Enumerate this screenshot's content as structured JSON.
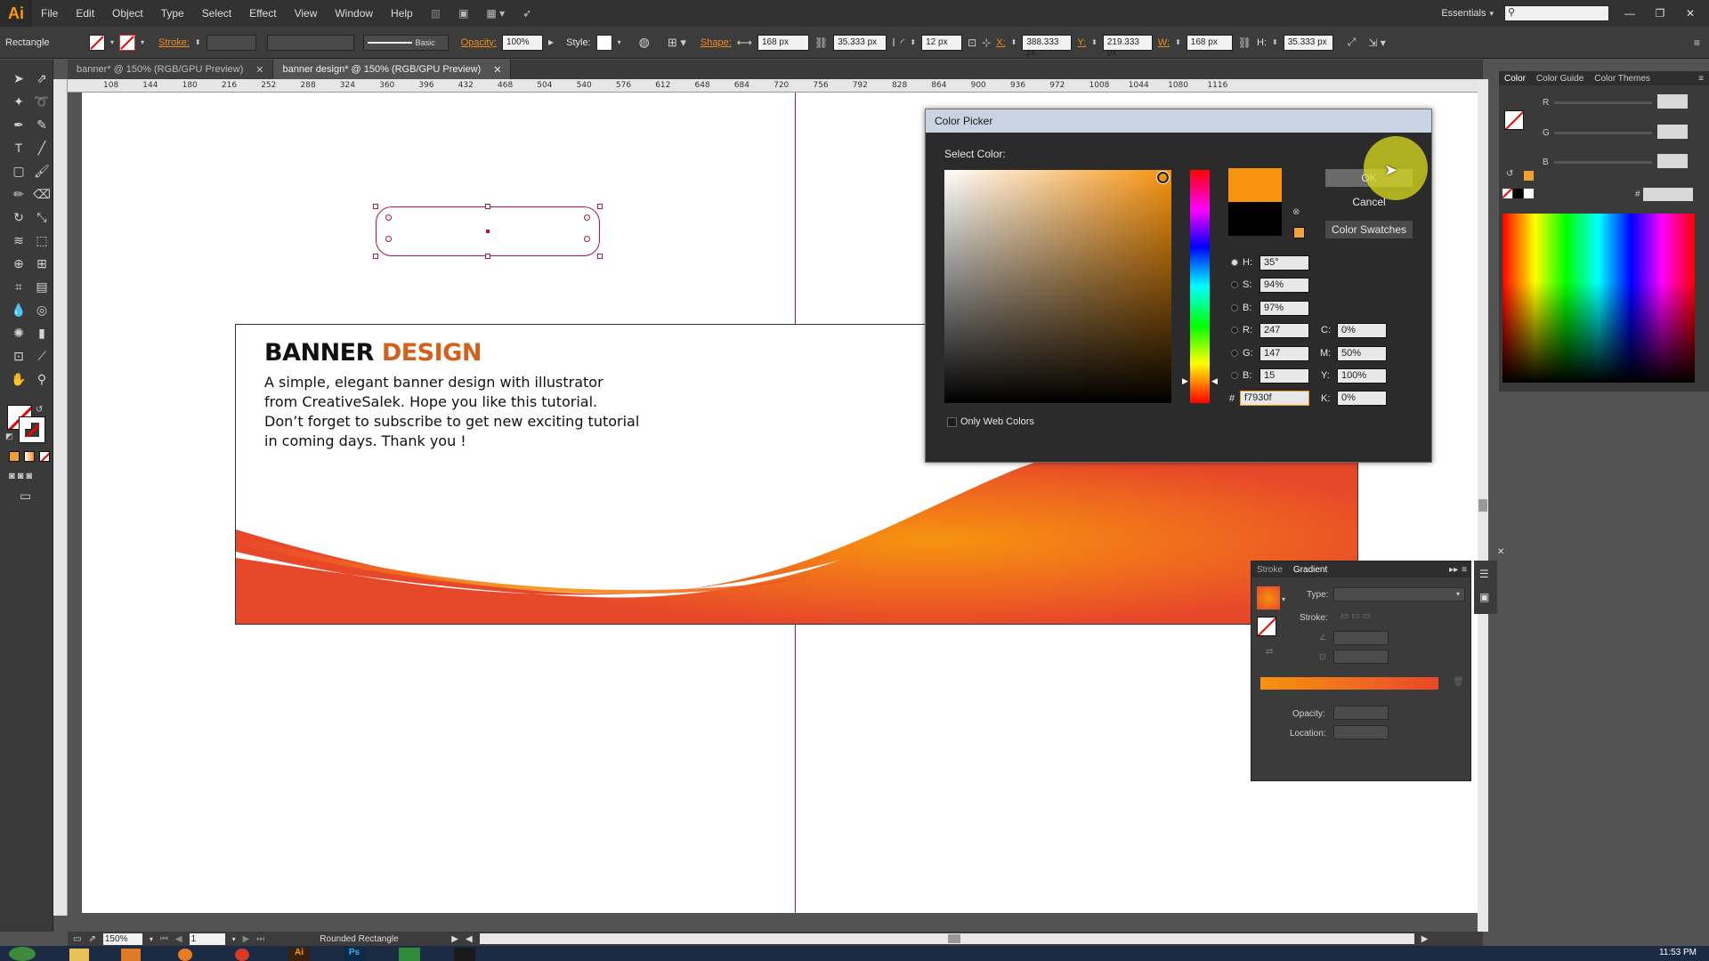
{
  "app": {
    "logo": "Ai",
    "menu": [
      "File",
      "Edit",
      "Object",
      "Type",
      "Select",
      "Effect",
      "View",
      "Window",
      "Help"
    ],
    "workspace": "Essentials"
  },
  "control_bar": {
    "tool_name": "Rectangle",
    "stroke_label": "Stroke:",
    "stroke_style": "Basic",
    "opacity_label": "Opacity:",
    "opacity_value": "100%",
    "style_label": "Style:",
    "shape_label": "Shape:",
    "width_value": "168 px",
    "height_value": "35.333 px",
    "radius_value": "12 px",
    "x_label": "X:",
    "x_value": "388.333 px",
    "y_label": "Y:",
    "y_value": "219.333 px",
    "w_label": "W:",
    "w_value": "168 px",
    "h_label": "H:",
    "h_value": "35.333 px"
  },
  "tabs": [
    {
      "label": "banner* @ 150% (RGB/GPU Preview)"
    },
    {
      "label": "banner design* @ 150% (RGB/GPU Preview)"
    }
  ],
  "ruler_ticks": [
    "108",
    "144",
    "180",
    "216",
    "252",
    "288",
    "324",
    "360",
    "396",
    "432",
    "468",
    "504",
    "540",
    "576",
    "612",
    "648",
    "684",
    "720",
    "756",
    "792",
    "828",
    "864",
    "900",
    "936",
    "972",
    "1008",
    "1044",
    "1080",
    "1116"
  ],
  "banner": {
    "title_part1": "BANNER",
    "title_part2": "DESIGN",
    "body": [
      "A simple, elegant banner design with illustrator",
      "from CreativeSalek. Hope you like this tutorial.",
      "Don’t forget to subscribe to get new exciting tutorial",
      "in coming days. Thank you !"
    ]
  },
  "color_picker": {
    "title": "Color Picker",
    "select_color": "Select Color:",
    "ok": "OK",
    "cancel": "Cancel",
    "swatches": "Color Swatches",
    "h_label": "H:",
    "h": "35°",
    "s_label": "S:",
    "s": "94%",
    "b_label": "B:",
    "b": "97%",
    "r_label": "R:",
    "r": "247",
    "g_label": "G:",
    "g": "147",
    "bb_label": "B:",
    "bb": "15",
    "hex_label": "#",
    "hex": "f7930f",
    "c_label": "C:",
    "c": "0%",
    "m_label": "M:",
    "m": "50%",
    "y_label": "Y:",
    "y": "100%",
    "k_label": "K:",
    "k": "0%",
    "only_web": "Only Web Colors",
    "new_color": "#f7930f",
    "old_color": "#000000"
  },
  "right_panel": {
    "tabs": [
      "Color",
      "Color Guide",
      "Color Themes"
    ],
    "r_label": "R",
    "g_label": "G",
    "b_label": "B",
    "hash": "#"
  },
  "gradient_panel": {
    "tabs": [
      "Stroke",
      "Gradient"
    ],
    "type_label": "Type:",
    "stroke_label": "Stroke:",
    "opacity_label": "Opacity:",
    "location_label": "Location:"
  },
  "status": {
    "zoom": "150%",
    "artboard": "1",
    "tool": "Rounded Rectangle"
  },
  "taskbar": {
    "clock": "11:53 PM"
  },
  "colors": {
    "accent_orange": "#f7930f",
    "banner_red": "#e8482a",
    "title_orange": "#d4611b",
    "guide": "#b0173b"
  }
}
